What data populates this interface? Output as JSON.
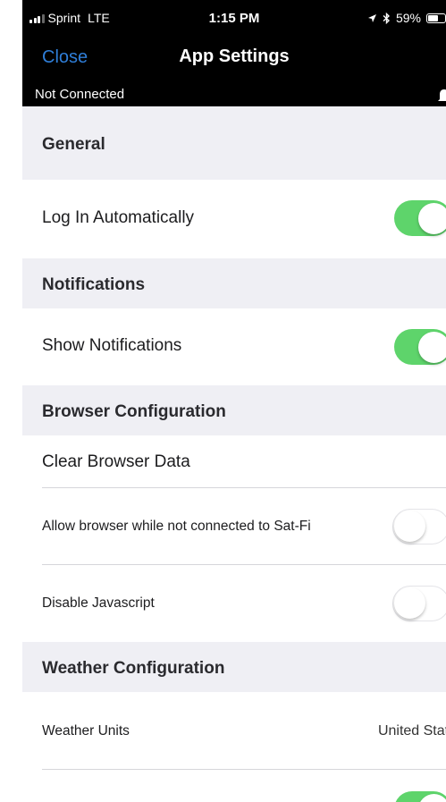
{
  "status_bar": {
    "carrier": "Sprint",
    "network": "LTE",
    "time": "1:15 PM",
    "battery": "59%",
    "battery_level": 0.59
  },
  "nav": {
    "close_label": "Close",
    "title": "App Settings"
  },
  "connection": {
    "status": "Not Connected"
  },
  "sections": {
    "general": "General",
    "notifications": "Notifications",
    "browser": "Browser Configuration",
    "weather": "Weather Configuration"
  },
  "items": {
    "log_in_automatically": {
      "label": "Log In Automatically",
      "on": true
    },
    "show_notifications": {
      "label": "Show Notifications",
      "on": true
    },
    "clear_browser_data": {
      "label": "Clear Browser Data"
    },
    "allow_browser": {
      "label": "Allow browser while not connected to Sat-Fi",
      "on": false
    },
    "disable_javascript": {
      "label": "Disable Javascript",
      "on": false
    },
    "weather_units": {
      "label": "Weather Units",
      "value": "United States"
    },
    "last_toggle": {
      "on": true
    }
  }
}
